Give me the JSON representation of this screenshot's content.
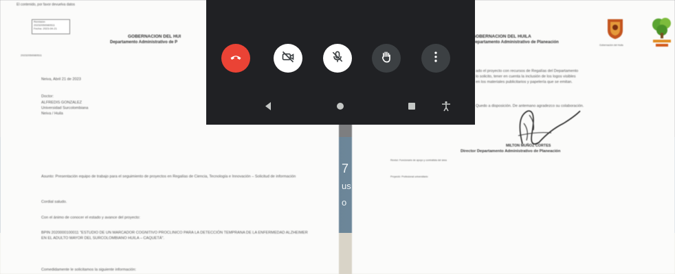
{
  "left_doc": {
    "top_note": "El contenido, por favor devuelva datos",
    "stamp_lines": [
      "Remisión",
      "20232050080511",
      "Fecha: 2023-04-21"
    ],
    "letterhead_title": "GOBERNACION DEL HUI",
    "letterhead_subtitle": "Departamento Administrativo de P",
    "ref_small": "20232050080511",
    "date_line": "Neiva, Abril 21 de 2023",
    "recipient": [
      "Doctor:",
      "ALFREDIS GONZALEZ",
      "Universidad Surcolombiana",
      "Neiva / Huila"
    ],
    "subject": "Asunto: Presentación equipo de trabajo para el seguimiento de proyectos en Regalías de Ciencia, Tecnología e Innovación – Solicitud de información",
    "greeting": "Cordial saludo.",
    "intro": "Con el ánimo de conocer el estado y avance del proyecto:",
    "project": "BPIN 2020000100011 \"ESTUDIO DE UN MARCADOR COGNITIVO PROCLINICO PARA LA DETECCIÓN TEMPRANA DE LA ENFERMEDAD ALZHEIMER EN EL ADULTO MAYOR DEL SURCOLOMBIANO HUILA – CAQUETÁ\".",
    "closing": "Comedidamente le solicitamos la siguiente información:"
  },
  "right_doc": {
    "letterhead_title": "GOBERNACION DEL HUILA",
    "letterhead_subtitle": "Departamento Administrativo de Planeación",
    "logo_caption": "Gobernación del Huila",
    "body_lines": [
      "ado el proyecto con recursos de Regalías del Departamento",
      "lo solicito, tener en cuenta la inclusión de los logos visibles",
      "en los materiales publicitarios y papelería que se emitan."
    ],
    "thanks_line": "Quedo a disposición. De antemano agradezco su colaboración.",
    "signer_name": "MILTON MUÑOZ CORTES",
    "signer_title": "Director Departamento Administrativo de Planeación",
    "footnote": "Revisó: Funcionario de apoyo y contratista del área",
    "projected": "Proyectó: Profesional universitario"
  },
  "call_controls": {
    "buttons": [
      {
        "name": "end-call",
        "icon": "phone-hangup-icon",
        "bg": "#ea4335"
      },
      {
        "name": "camera-off",
        "icon": "camera-off-icon",
        "bg": "#ffffff"
      },
      {
        "name": "mic-off",
        "icon": "mic-off-icon",
        "bg": "#ffffff"
      },
      {
        "name": "raise-hand",
        "icon": "hand-icon",
        "bg": "#3c4043"
      },
      {
        "name": "more-options",
        "icon": "more-vert-icon",
        "bg": "#3c4043"
      }
    ],
    "nav_icons": [
      "back-icon",
      "home-icon",
      "recents-icon",
      "accessibility-icon"
    ]
  },
  "background_text": {
    "line1": "7",
    "line2": "us",
    "line3": "o"
  },
  "colors": {
    "call_bg": "#202124",
    "end_call": "#ea4335",
    "paper": "#fbfbfa",
    "backdrop": "#7d7e80"
  }
}
